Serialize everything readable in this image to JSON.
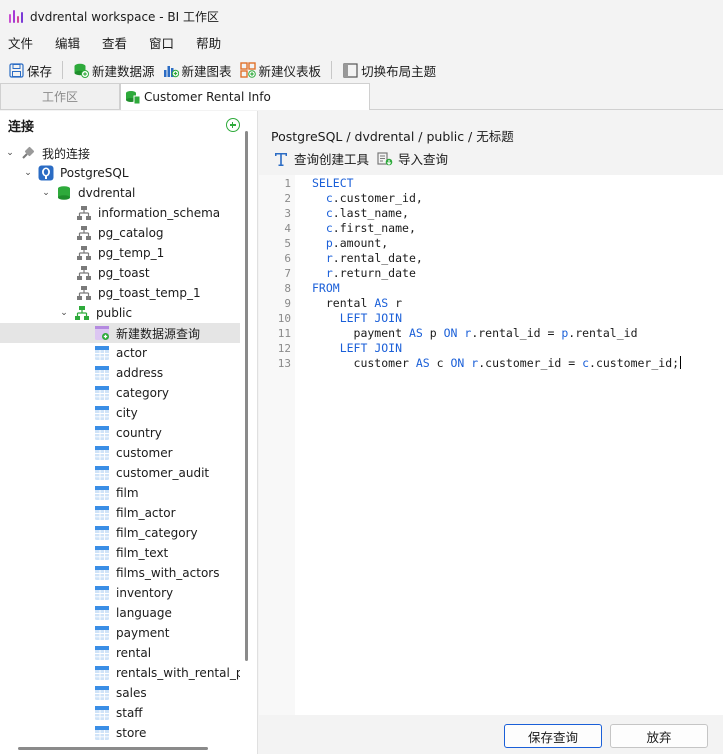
{
  "window": {
    "title": "dvdrental workspace - BI 工作区"
  },
  "menu": [
    "文件",
    "编辑",
    "查看",
    "窗口",
    "帮助"
  ],
  "toolbar": {
    "save": "保存",
    "new_datasource": "新建数据源",
    "new_chart": "新建图表",
    "new_dashboard": "新建仪表板",
    "switch_theme": "切换布局主题"
  },
  "tabs": {
    "workspace": "工作区",
    "active": "Customer Rental Info"
  },
  "sidebar": {
    "title": "连接",
    "my_connections": "我的连接",
    "server": "PostgreSQL",
    "database": "dvdrental",
    "schemas": [
      "information_schema",
      "pg_catalog",
      "pg_temp_1",
      "pg_toast",
      "pg_toast_temp_1"
    ],
    "public": "public",
    "new_query": "新建数据源查询",
    "tables": [
      "actor",
      "address",
      "category",
      "city",
      "country",
      "customer",
      "customer_audit",
      "film",
      "film_actor",
      "film_category",
      "film_text",
      "films_with_actors",
      "inventory",
      "language",
      "payment",
      "rental",
      "rentals_with_rental_peri",
      "sales",
      "staff",
      "store"
    ]
  },
  "main": {
    "breadcrumb": "PostgreSQL / dvdrental / public / 无标题",
    "query_builder": "查询创建工具",
    "import_query": "导入查询",
    "sql_lines": [
      "SELECT",
      "  c.customer_id,",
      "  c.last_name,",
      "  c.first_name,",
      "  p.amount,",
      "  r.rental_date,",
      "  r.return_date",
      "FROM",
      "  rental AS r",
      "    LEFT JOIN",
      "      payment AS p ON r.rental_id = p.rental_id",
      "    LEFT JOIN",
      "      customer AS c ON r.customer_id = c.customer_id;"
    ],
    "save_button": "保存查询",
    "discard_button": "放弃"
  },
  "colors": {
    "keyword": "#1a5fd8",
    "accent": "#2eaa3b",
    "table_icon": "#3a8ee6"
  }
}
